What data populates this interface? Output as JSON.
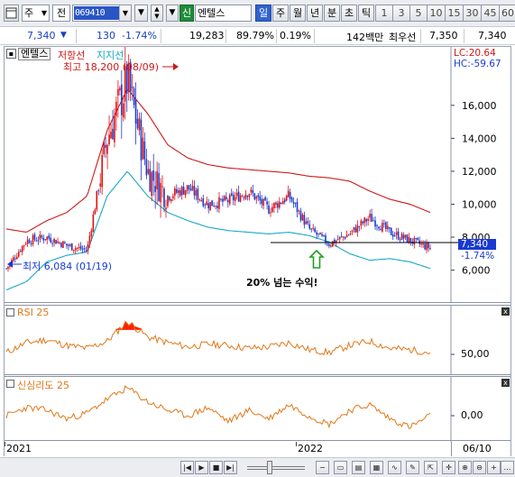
{
  "toolbar": {
    "menu_icon": "chart-menu-icon",
    "market_select": "주",
    "pc_select": "전",
    "code_value": "069410",
    "stock_name": "엔텔스",
    "sin_badge": "신",
    "buttons": [
      "일",
      "주",
      "월",
      "년",
      "분",
      "초",
      "틱"
    ],
    "active_button": "일",
    "periods": [
      "1",
      "3",
      "5",
      "10",
      "15",
      "30",
      "45",
      "60"
    ]
  },
  "info": {
    "price": "7,340",
    "change_arrow": "▼",
    "change": "130",
    "change_pct": "-1.74%",
    "volume": "19,283",
    "vol_ratio": "89.79%",
    "turnover": "0.19%",
    "amount": "142백만",
    "best_ask_label": "최우선",
    "best_ask": "7,350",
    "best_bid": "7,340"
  },
  "main_chart": {
    "name_box": "엔텔스",
    "legend_resistance": "저항선",
    "legend_support": "지지선",
    "lc_label": "LC:20.64",
    "hc_label": "HC:-59.67",
    "high_label": "최고 18,200 (08/09)",
    "low_label": "최저 6,084 (01/19)",
    "annotation": "20% 넘는 수익!",
    "price_box": "7,340",
    "price_change": "-1.74%",
    "colors": {
      "candle_up": "#e01010",
      "candle_down": "#1a3ad0",
      "resistance": "#d01818",
      "support": "#18a8c8",
      "annotation_arrow": "#22a022"
    }
  },
  "rsi": {
    "label": "RSI 25",
    "level_label": "50,00",
    "color": "#e07818",
    "overbought_color": "#ff2000"
  },
  "psych": {
    "label": "신심리도 25",
    "level_label": "0,00",
    "color": "#e07818"
  },
  "x_axis": {
    "labels": [
      "2021",
      "2022"
    ],
    "right_date": "06/10"
  },
  "chart_data": [
    {
      "type": "line",
      "title": "엔텔스",
      "series": [
        {
          "name": "저항선",
          "values": [
            8500,
            8300,
            9000,
            9500,
            10500,
            14500,
            17000,
            15500,
            13600,
            12800,
            12400,
            12200,
            12100,
            12000,
            11900,
            11700,
            11600,
            11400,
            10800,
            10300,
            10000,
            9500
          ]
        },
        {
          "name": "지지선",
          "values": [
            4800,
            5300,
            6500,
            6900,
            7100,
            10500,
            12000,
            10500,
            9500,
            9000,
            8600,
            8400,
            8300,
            8200,
            8300,
            8100,
            7700,
            7000,
            6600,
            6700,
            6500,
            6100
          ]
        },
        {
          "name": "종가",
          "values": [
            6100,
            7800,
            8000,
            7500,
            7200,
            14000,
            17500,
            12000,
            10500,
            11000,
            10000,
            10200,
            10800,
            9700,
            10500,
            8500,
            7600,
            8200,
            9200,
            8300,
            7800,
            7340
          ]
        }
      ],
      "y_ticks": [
        6000,
        8000,
        10000,
        12000,
        14000,
        16000
      ],
      "ylim": [
        4500,
        19000
      ],
      "last_close": 7340,
      "high": 18200,
      "low": 6084
    },
    {
      "type": "line",
      "title": "RSI 25",
      "y_ticks": [
        50
      ],
      "series": [
        {
          "name": "RSI 25",
          "values": [
            44,
            51,
            53,
            49,
            47,
            52,
            66,
            55,
            51,
            48,
            50,
            49,
            47,
            48,
            51,
            46,
            44,
            49,
            52,
            47,
            46,
            44
          ]
        }
      ]
    },
    {
      "type": "line",
      "title": "신심리도 25",
      "y_ticks": [
        0
      ],
      "series": [
        {
          "name": "신심리도 25",
          "values": [
            -5,
            10,
            5,
            -10,
            0,
            25,
            45,
            20,
            5,
            -5,
            10,
            -15,
            5,
            -10,
            15,
            -5,
            -20,
            5,
            15,
            -10,
            -25,
            -5
          ]
        }
      ]
    }
  ]
}
